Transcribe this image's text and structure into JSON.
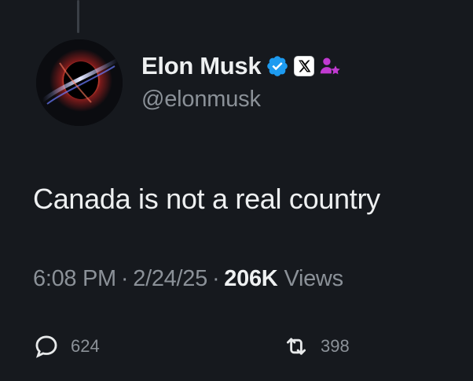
{
  "author": {
    "display_name": "Elon Musk",
    "handle": "@elonmusk",
    "verified_badge_color": "#1d9bf0",
    "affiliation_badge_color": "#c13ad1",
    "icons": [
      "verified-check-icon",
      "x-logo-icon",
      "affiliate-person-star-icon"
    ]
  },
  "tweet": {
    "text": "Canada is not a real country",
    "time": "6:08 PM",
    "separator": "·",
    "date": "2/24/25",
    "views_count": "206K",
    "views_label": "Views"
  },
  "actions": {
    "reply": {
      "count": "624",
      "icon": "reply-bubble-icon"
    },
    "repost": {
      "count": "398",
      "icon": "repost-arrows-icon"
    }
  },
  "colors": {
    "background": "#16191e",
    "primary_text": "#eef0f1",
    "secondary_text": "#8b9198"
  }
}
